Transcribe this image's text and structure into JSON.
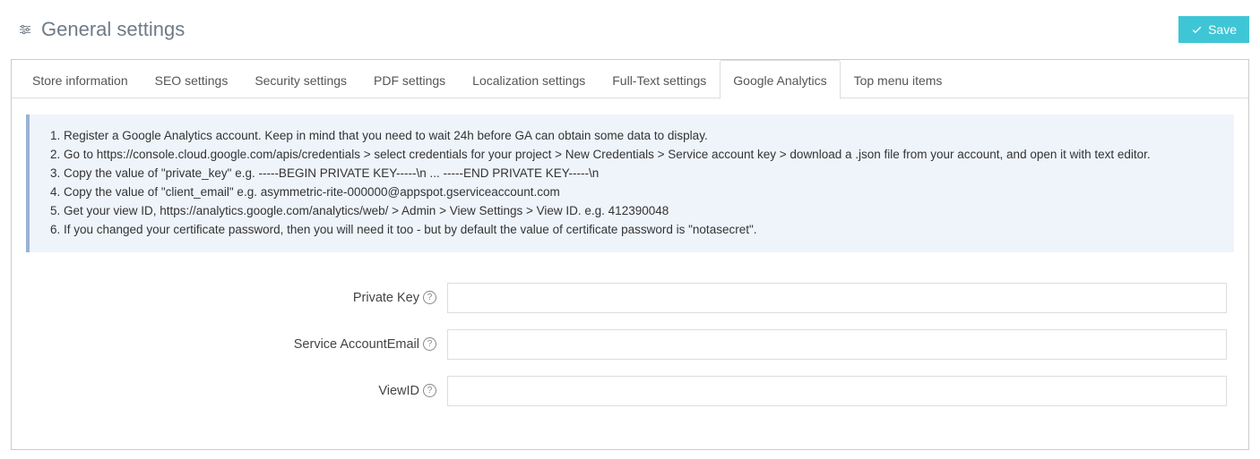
{
  "header": {
    "title": "General settings",
    "save_label": "Save"
  },
  "tabs": [
    "Store information",
    "SEO settings",
    "Security settings",
    "PDF settings",
    "Localization settings",
    "Full-Text settings",
    "Google Analytics",
    "Top menu items"
  ],
  "active_tab": "Google Analytics",
  "instructions": [
    "Register a Google Analytics account. Keep in mind that you need to wait 24h before GA can obtain some data to display.",
    "Go to https://console.cloud.google.com/apis/credentials > select credentials for your project > New Credentials > Service account key > download a .json file from your account, and open it with text editor.",
    "Copy the value of \"private_key\" e.g. -----BEGIN PRIVATE KEY-----\\n ... -----END PRIVATE KEY-----\\n",
    "Copy the value of \"client_email\" e.g. asymmetric-rite-000000@appspot.gserviceaccount.com",
    "Get your view ID, https://analytics.google.com/analytics/web/ > Admin > View Settings > View ID. e.g. 412390048",
    "If you changed your certificate password, then you will need it too - but by default the value of certificate password is \"notasecret\"."
  ],
  "fields": {
    "private_key": {
      "label": "Private Key",
      "value": ""
    },
    "service_email": {
      "label": "Service AccountEmail",
      "value": ""
    },
    "view_id": {
      "label": "ViewID",
      "value": ""
    }
  }
}
